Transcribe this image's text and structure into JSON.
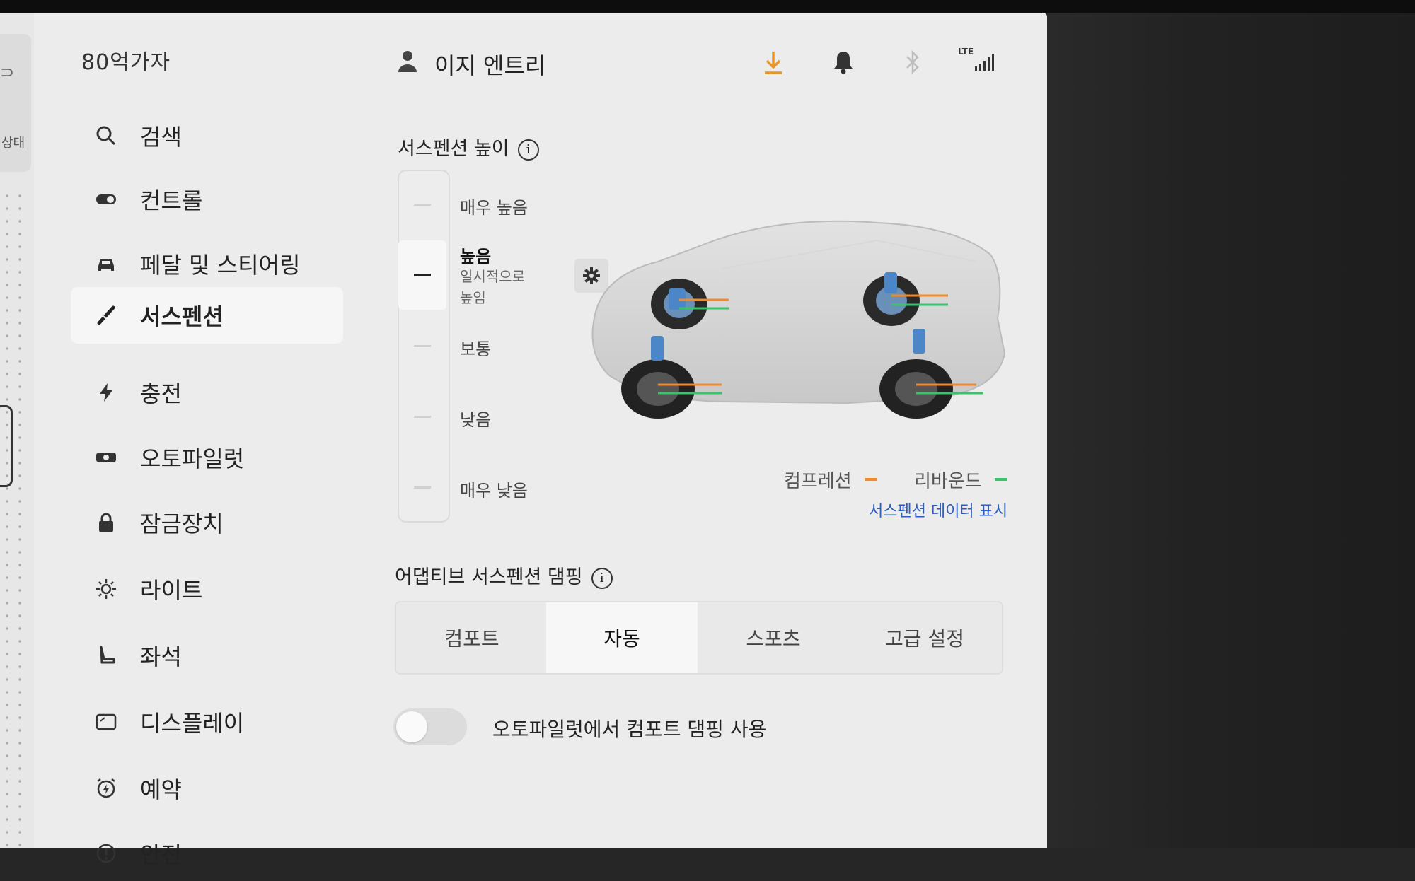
{
  "sidebar": {
    "brand": "80억가자",
    "status_label": "상태",
    "items": [
      {
        "label": "검색",
        "icon": "search-icon"
      },
      {
        "label": "컨트롤",
        "icon": "toggle-icon"
      },
      {
        "label": "페달 및 스티어링",
        "icon": "car-icon"
      },
      {
        "label": "서스펜션",
        "icon": "suspension-icon",
        "active": true
      },
      {
        "label": "충전",
        "icon": "lightning-icon"
      },
      {
        "label": "오토파일럿",
        "icon": "steering-wheel-icon"
      },
      {
        "label": "잠금장치",
        "icon": "lock-icon"
      },
      {
        "label": "라이트",
        "icon": "light-icon"
      },
      {
        "label": "좌석",
        "icon": "seat-icon"
      },
      {
        "label": "디스플레이",
        "icon": "display-icon"
      },
      {
        "label": "예약",
        "icon": "alarm-icon"
      },
      {
        "label": "안전",
        "icon": "warning-icon"
      }
    ]
  },
  "header": {
    "user_name": "이지 엔트리",
    "network_label": "LTE",
    "colors": {
      "download": "#e8962a",
      "bluetooth": "#bdbdbd"
    }
  },
  "suspension": {
    "title": "서스펜션 높이",
    "levels": [
      "매우 높음",
      "높음",
      "보통",
      "낮음",
      "매우 낮음"
    ],
    "selected": "높음",
    "selected_sub": [
      "일시적으로",
      "높임"
    ],
    "legend": {
      "compression": "컴프레션",
      "rebound": "리바운드",
      "compression_color": "#f08a2a",
      "rebound_color": "#39c46a"
    },
    "data_link": "서스펜션 데이터 표시"
  },
  "damping": {
    "title": "어댑티브 서스펜션 댐핑",
    "options": [
      "컴포트",
      "자동",
      "스포츠",
      "고급 설정"
    ],
    "selected": "자동"
  },
  "autopilot_comfort": {
    "label": "오토파일럿에서 컴포트 댐핑 사용",
    "enabled": false
  }
}
